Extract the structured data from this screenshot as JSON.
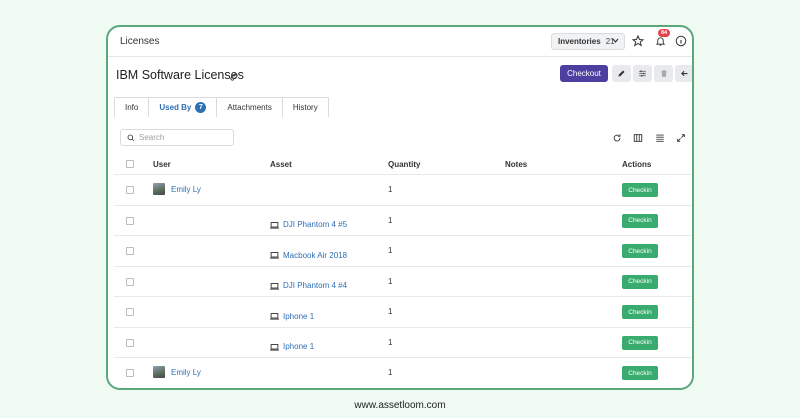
{
  "app": {
    "breadcrumb": "Licenses"
  },
  "topbar": {
    "inventory_label": "Inventories",
    "inventory_count": "21",
    "notification_count": "84"
  },
  "page": {
    "title": "IBM Software Licenses",
    "checkout_label": "Checkout"
  },
  "tabs": [
    {
      "label": "Info"
    },
    {
      "label": "Used By",
      "count": "7"
    },
    {
      "label": "Attachments"
    },
    {
      "label": "History"
    }
  ],
  "search": {
    "placeholder": "Search"
  },
  "table": {
    "headers": {
      "user": "User",
      "asset": "Asset",
      "quantity": "Quantity",
      "notes": "Notes",
      "actions": "Actions"
    },
    "rows": [
      {
        "user": "Emily Ly",
        "asset": "",
        "quantity": "1",
        "action": "Checkin"
      },
      {
        "user": "",
        "asset": "DJI Phantom 4 #5",
        "quantity": "1",
        "action": "Checkin"
      },
      {
        "user": "",
        "asset": "Macbook Air 2018",
        "quantity": "1",
        "action": "Checkin"
      },
      {
        "user": "",
        "asset": "DJI Phantom 4 #4",
        "quantity": "1",
        "action": "Checkin"
      },
      {
        "user": "",
        "asset": "Iphone 1",
        "quantity": "1",
        "action": "Checkin"
      },
      {
        "user": "",
        "asset": "Iphone 1",
        "quantity": "1",
        "action": "Checkin"
      },
      {
        "user": "Emily Ly",
        "asset": "",
        "quantity": "1",
        "action": "Checkin"
      }
    ]
  },
  "footer": {
    "url": "www.assetloom.com"
  },
  "colors": {
    "accent": "#4b3f9f",
    "link": "#2f6fb5",
    "success": "#3aab6f",
    "frame": "#5aa87a",
    "background": "#eefaf2"
  }
}
